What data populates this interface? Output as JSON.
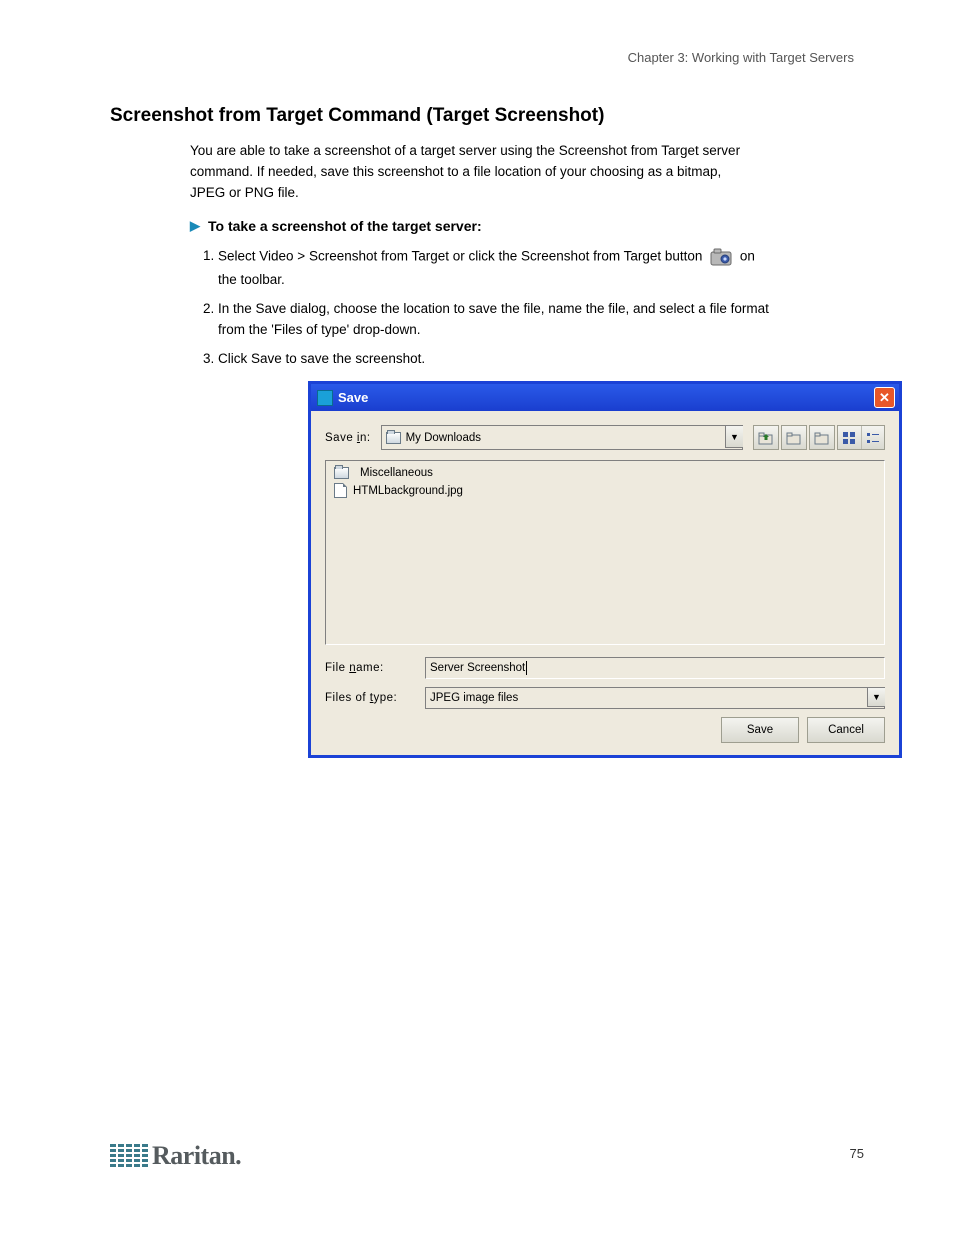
{
  "chapter_ref": "Chapter 3: Working with Target Servers",
  "section_title": "Screenshot from Target Command (Target Screenshot)",
  "intro_p1": "You are able to take a screenshot of a target server using the Screenshot from Target server command. If needed, save this screenshot to a file location of your choosing as a bitmap, JPEG or PNG file.",
  "proc_heading": "To take a screenshot of the target server:",
  "step1_text": "Select Video > Screenshot from Target or click the Screenshot from Target button ",
  "step1_text_after": " on the toolbar.",
  "step2_text": "In the Save dialog, choose the location to save the file, name the file, and select a file format from the 'Files of type' drop-down.",
  "step3_text": "Click Save to save the screenshot.",
  "dialog": {
    "title": "Save",
    "save_in_label": "Save in:",
    "save_in_value": "My Downloads",
    "file_area": {
      "items": [
        {
          "type": "folder",
          "label": "Miscellaneous"
        },
        {
          "type": "file",
          "label": "HTMLbackground.jpg"
        }
      ]
    },
    "file_name_label": "File name:",
    "file_name_value": "Server Screenshot",
    "files_of_type_label": "Files of type:",
    "files_of_type_value": "JPEG image files",
    "save_button": "Save",
    "cancel_button": "Cancel"
  },
  "logo_text": "Raritan.",
  "page_number": "75"
}
